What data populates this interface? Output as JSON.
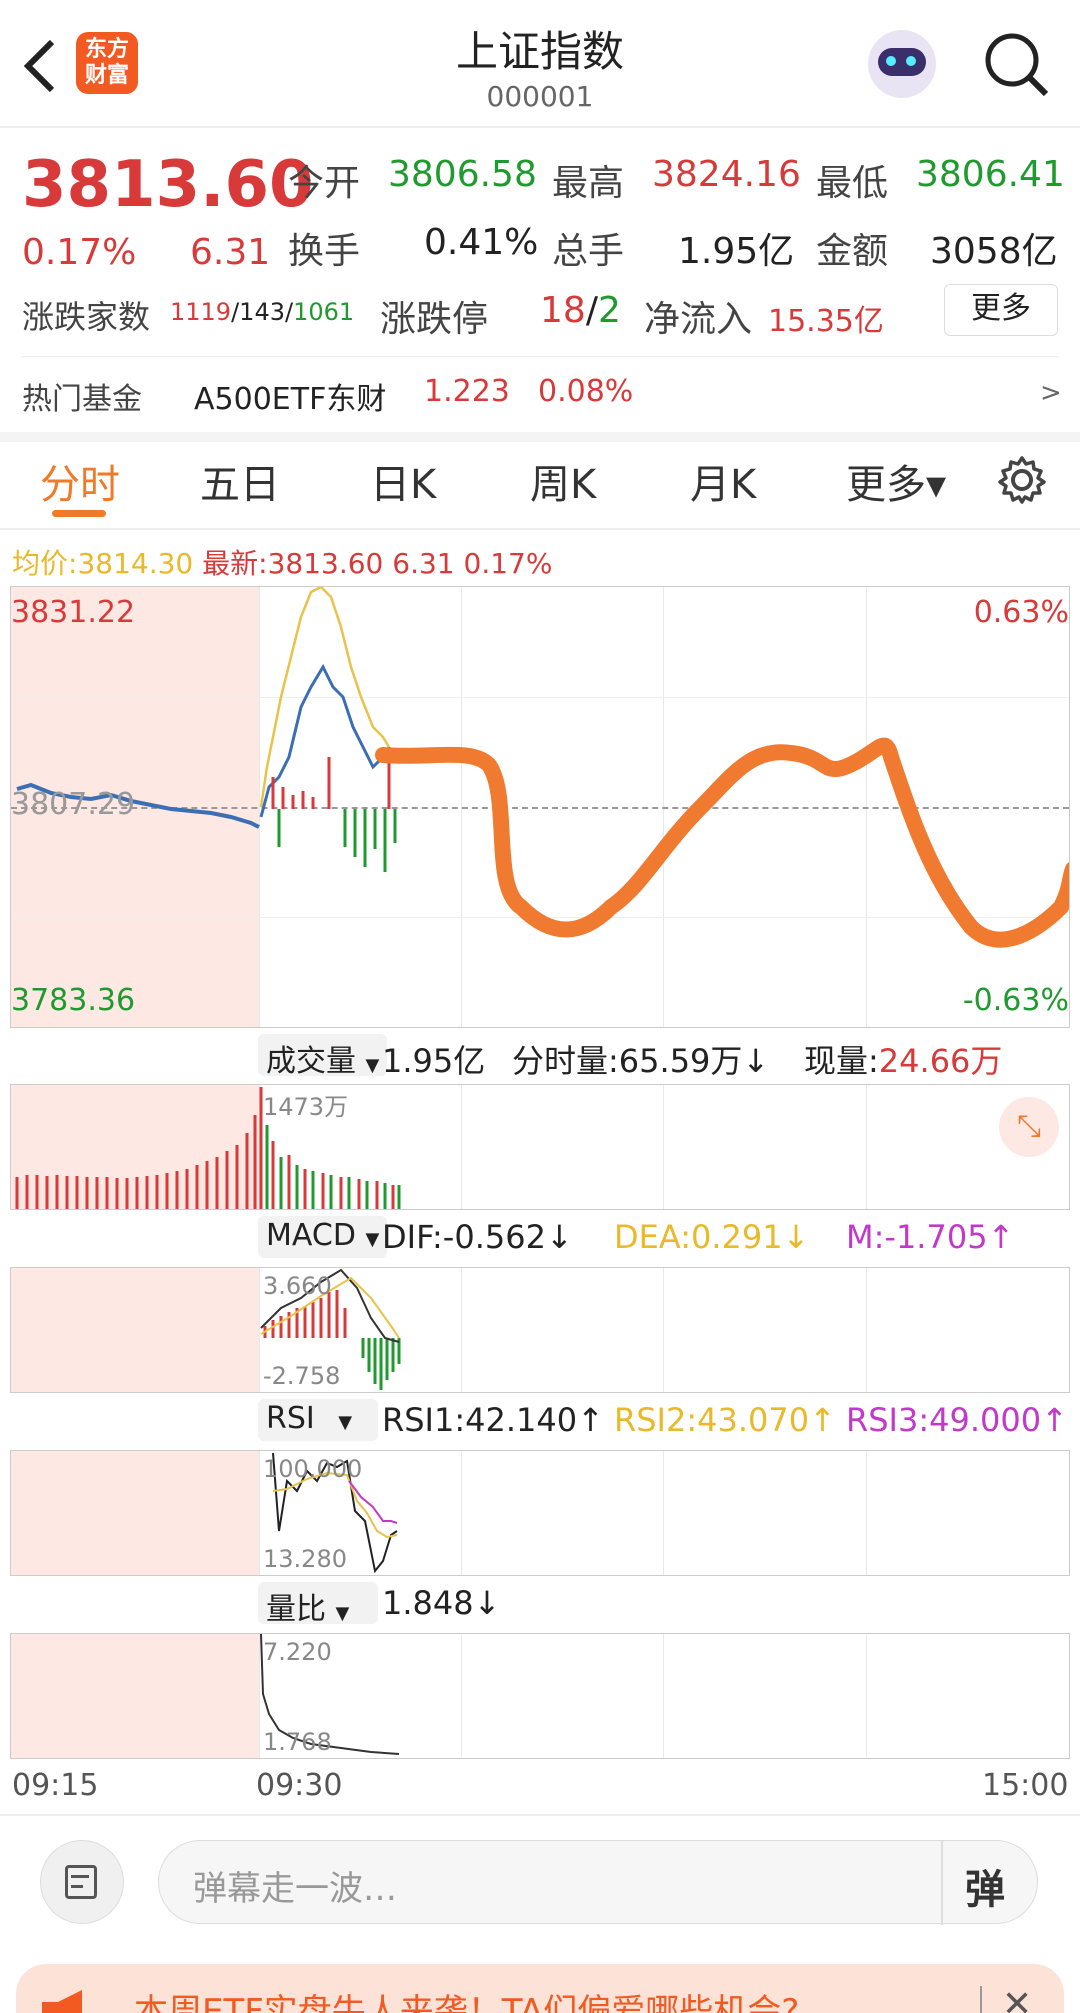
{
  "header": {
    "title": "上证指数",
    "code": "000001",
    "logo_line1": "东方",
    "logo_line2": "财富"
  },
  "quote": {
    "price": "3813.60",
    "pct": "0.17%",
    "change": "6.31",
    "open_label": "今开",
    "open": "3806.58",
    "high_label": "最高",
    "high": "3824.16",
    "low_label": "最低",
    "low": "3806.41",
    "turnover_label": "换手",
    "turnover": "0.41%",
    "volume_label": "总手",
    "volume": "1.95亿",
    "amount_label": "金额",
    "amount": "3058亿",
    "breadth_label": "涨跌家数",
    "breadth_up": "1119",
    "breadth_flat": "143",
    "breadth_down": "1061",
    "sep": "/",
    "limit_label": "涨跌停",
    "limit_up": "18",
    "limit_down": "2",
    "inflow_label": "净流入",
    "inflow": "15.35亿",
    "more_button": "更多"
  },
  "fund": {
    "label": "热门基金",
    "name": "A500ETF东财",
    "price": "1.223",
    "pct": "0.08%",
    "arrow": ">"
  },
  "tabs": [
    {
      "label": "分时"
    },
    {
      "label": "五日"
    },
    {
      "label": "日K"
    },
    {
      "label": "周K"
    },
    {
      "label": "月K"
    },
    {
      "label": "更多▾"
    }
  ],
  "summary": {
    "avg_label": "均价:",
    "avg": "3814.30",
    "latest_label": "最新:",
    "latest": "3813.60",
    "change": "6.31",
    "pct": "0.17%"
  },
  "main_chart": {
    "y_top": "3831.22",
    "y_mid": "3807.29",
    "y_bottom": "3783.36",
    "pct_top": "0.63%",
    "pct_bottom": "-0.63%"
  },
  "volume": {
    "selector": "成交量",
    "total": "1.95亿",
    "minute_label": "分时量:",
    "minute": "65.59万",
    "arrow": "↓",
    "current_label": "现量:",
    "current": "24.66万",
    "max_label": "1473万"
  },
  "macd": {
    "selector": "MACD",
    "dif": "DIF:-0.562↓",
    "dea": "DEA:0.291↓",
    "m": "M:-1.705↑",
    "top": "3.660",
    "bottom": "-2.758"
  },
  "rsi": {
    "selector": "RSI",
    "rsi1": "RSI1:42.140↑",
    "rsi2": "RSI2:43.070↑",
    "rsi3": "RSI3:49.000↑",
    "top": "100.000",
    "bottom": "13.280"
  },
  "vr": {
    "selector": "量比",
    "value": "1.848↓",
    "top": "7.220",
    "bottom": "1.768"
  },
  "time_axis": {
    "start": "09:15",
    "open": "09:30",
    "end": "15:00"
  },
  "comment": {
    "placeholder": "弹幕走一波…",
    "danmu_btn": "弹"
  },
  "banner": {
    "text": "本周ETF实盘牛人来袭！TA们偏爱哪些机会?"
  }
}
